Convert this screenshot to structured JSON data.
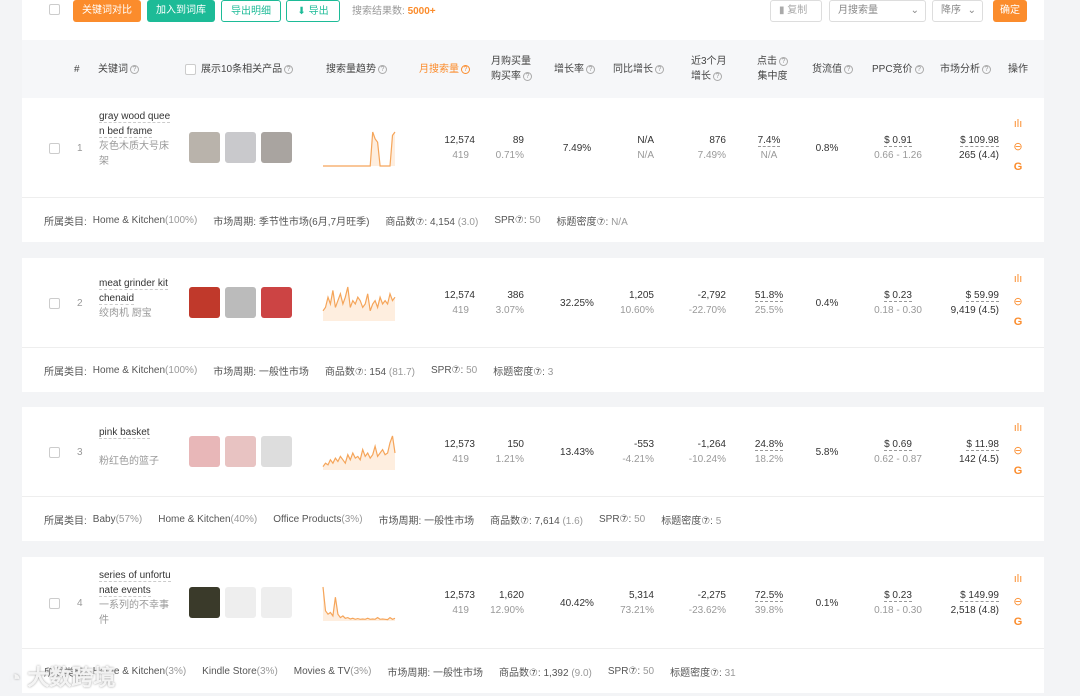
{
  "toolbar": {
    "compare": "关键词对比",
    "add_lib": "加入到词库",
    "export_detail": "导出明细",
    "export": "导出",
    "result_label": "搜索结果数:",
    "result_count": "5000+",
    "copy": "复制",
    "sort_field": "月搜索量",
    "sort_order": "降序",
    "confirm": "确定"
  },
  "header": {
    "index": "#",
    "keyword": "关键词",
    "show_products": "展示10条相关产品",
    "trend": "搜索量趋势",
    "monthly": "月搜索量",
    "purchase_1": "月购买量",
    "purchase_2": "购买率",
    "growth": "增长率",
    "yoy": "同比增长",
    "m3_1": "近3个月",
    "m3_2": "增长",
    "click_1": "点击",
    "click_2": "集中度",
    "cargo": "货流值",
    "ppc": "PPC竞价",
    "market": "市场分析",
    "ops": "操作"
  },
  "rows": [
    {
      "index": "1",
      "keyword": "gray wood queen bed frame",
      "keyword_zh": "灰色木质大号床架",
      "monthly": "12,574",
      "monthly_sub": "419",
      "purchase": "89",
      "purchase_rate": "0.71%",
      "growth": "7.49%",
      "yoy": "N/A",
      "yoy_sub": "N/A",
      "m3": "876",
      "m3_sub": "7.49%",
      "click": "7.4%",
      "click_sub": "N/A",
      "cargo": "0.8%",
      "ppc": "$ 0.91",
      "ppc_range": "0.66 - 1.26",
      "market": "$ 109.98",
      "market_sub": "265 (4.4)",
      "trend": [
        0,
        0,
        0,
        0,
        0,
        0,
        0,
        0,
        0,
        0,
        0,
        0,
        0,
        0,
        0,
        0,
        0,
        0,
        0,
        0,
        1,
        0.8,
        0.7,
        0,
        0,
        0,
        0,
        0,
        0.9,
        1
      ],
      "footer": {
        "cat_label": "所属类目:",
        "cats": [
          [
            "Home & Kitchen",
            "(100%)"
          ]
        ],
        "cycle": "市场周期: 季节性市场(6月,7月旺季)",
        "products_label": "商品数⑦:",
        "products": "4,154",
        "products_sub": "(3.0)",
        "spr_label": "SPR⑦:",
        "spr": "50",
        "density_label": "标题密度⑦:",
        "density": "N/A"
      }
    },
    {
      "index": "2",
      "keyword": "meat grinder kitchenaid",
      "keyword_zh": "绞肉机 厨宝",
      "monthly": "12,574",
      "monthly_sub": "419",
      "purchase": "386",
      "purchase_rate": "3.07%",
      "growth": "32.25%",
      "yoy": "1,205",
      "yoy_sub": "10.60%",
      "m3": "-2,792",
      "m3_sub": "-22.70%",
      "click": "51.8%",
      "click_sub": "25.5%",
      "cargo": "0.4%",
      "ppc": "$ 0.23",
      "ppc_range": "0.18 - 0.30",
      "market": "$ 59.99",
      "market_sub": "9,419 (4.5)",
      "trend": [
        0.3,
        0.4,
        0.7,
        0.5,
        0.9,
        0.4,
        0.6,
        0.8,
        0.5,
        0.7,
        1,
        0.4,
        0.6,
        0.5,
        0.7,
        0.6,
        0.4,
        0.5,
        0.8,
        0.3,
        0.5,
        0.6,
        0.4,
        0.7,
        0.5,
        0.6,
        0.5,
        0.8,
        0.6,
        0.7
      ],
      "footer": {
        "cat_label": "所属类目:",
        "cats": [
          [
            "Home & Kitchen",
            "(100%)"
          ]
        ],
        "cycle": "市场周期: 一般性市场",
        "products_label": "商品数⑦:",
        "products": "154",
        "products_sub": "(81.7)",
        "spr_label": "SPR⑦:",
        "spr": "50",
        "density_label": "标题密度⑦:",
        "density": "3"
      }
    },
    {
      "index": "3",
      "keyword": "pink basket",
      "keyword_zh": "粉红色的篮子",
      "monthly": "12,573",
      "monthly_sub": "419",
      "purchase": "150",
      "purchase_rate": "1.21%",
      "growth": "13.43%",
      "yoy": "-553",
      "yoy_sub": "-4.21%",
      "m3": "-1,264",
      "m3_sub": "-10.24%",
      "click": "24.8%",
      "click_sub": "18.2%",
      "cargo": "5.8%",
      "ppc": "$ 0.69",
      "ppc_range": "0.62 - 0.87",
      "market": "$ 11.98",
      "market_sub": "142 (4.5)",
      "trend": [
        0.1,
        0.2,
        0.15,
        0.3,
        0.2,
        0.35,
        0.25,
        0.4,
        0.3,
        0.2,
        0.45,
        0.3,
        0.5,
        0.35,
        0.4,
        0.3,
        0.6,
        0.4,
        0.5,
        0.35,
        0.45,
        0.7,
        0.4,
        0.5,
        0.6,
        0.45,
        0.5,
        0.8,
        1,
        0.5
      ],
      "footer": {
        "cat_label": "所属类目:",
        "cats": [
          [
            "Baby",
            "(57%)"
          ],
          [
            "Home & Kitchen",
            "(40%)"
          ],
          [
            "Office Products",
            "(3%)"
          ]
        ],
        "cycle": "市场周期: 一般性市场",
        "products_label": "商品数⑦:",
        "products": "7,614",
        "products_sub": "(1.6)",
        "spr_label": "SPR⑦:",
        "spr": "50",
        "density_label": "标题密度⑦:",
        "density": "5"
      }
    },
    {
      "index": "4",
      "keyword": "series of unfortunate events",
      "keyword_zh": "一系列的不幸事件",
      "monthly": "12,573",
      "monthly_sub": "419",
      "purchase": "1,620",
      "purchase_rate": "12.90%",
      "growth": "40.42%",
      "yoy": "5,314",
      "yoy_sub": "73.21%",
      "m3": "-2,275",
      "m3_sub": "-23.62%",
      "click": "72.5%",
      "click_sub": "39.8%",
      "cargo": "0.1%",
      "ppc": "$ 0.23",
      "ppc_range": "0.18 - 0.30",
      "market": "$ 149.99",
      "market_sub": "2,518 (4.8)",
      "trend": [
        1,
        0.3,
        0.2,
        0.25,
        0.15,
        0.7,
        0.2,
        0.1,
        0.15,
        0.08,
        0.1,
        0.06,
        0.08,
        0.05,
        0.07,
        0.05,
        0.06,
        0.05,
        0.08,
        0.05,
        0.06,
        0.05,
        0.1,
        0.05,
        0.06,
        0.05,
        0.04,
        0.1,
        0.05,
        0.08
      ],
      "footer": {
        "cat_label": "所属类目:",
        "cats": [
          [
            "Home & Kitchen",
            "(3%)"
          ],
          [
            "Kindle Store",
            "(3%)"
          ],
          [
            "Movies & TV",
            "(3%)"
          ]
        ],
        "cycle": "市场周期: 一般性市场",
        "products_label": "商品数⑦:",
        "products": "1,392",
        "products_sub": "(9.0)",
        "spr_label": "SPR⑦:",
        "spr": "50",
        "density_label": "标题密度⑦:",
        "density": "31"
      }
    }
  ],
  "watermark": "大数跨境",
  "colors": {
    "orange": "#fb8c2c",
    "green": "#1dbb97"
  }
}
